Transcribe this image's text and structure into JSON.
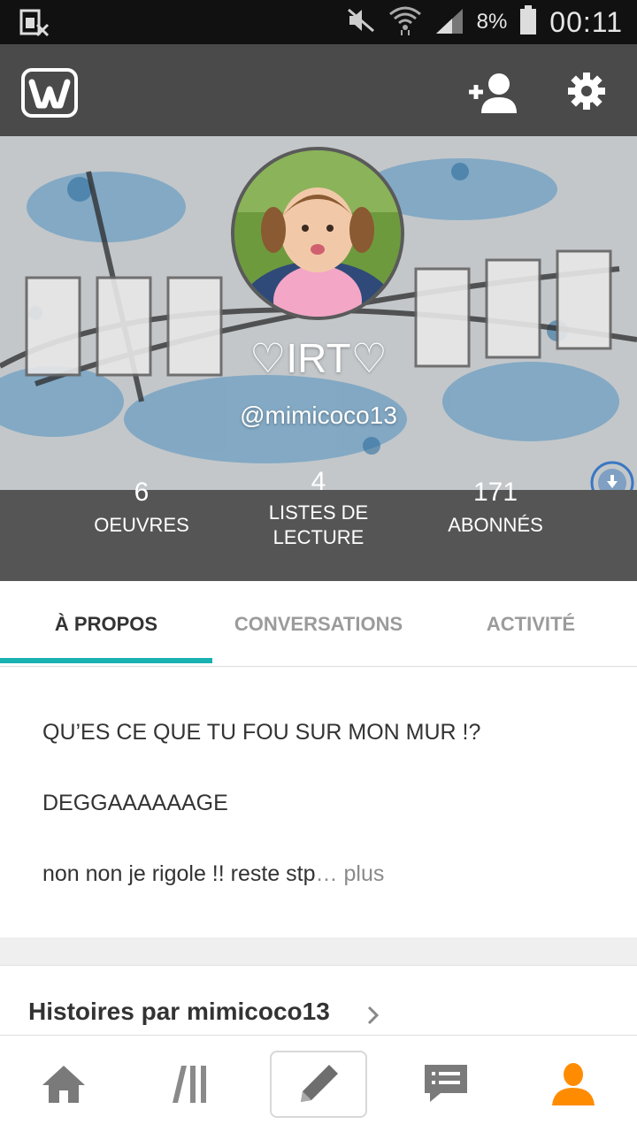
{
  "status_bar": {
    "battery_percent": "8%",
    "time": "00:11",
    "icons": [
      "sim-card-missing-icon",
      "mute-icon",
      "wifi-icon",
      "signal-icon",
      "battery-icon"
    ]
  },
  "app_bar": {
    "logo_icon": "wattpad-logo-icon",
    "actions": [
      "add-user-icon",
      "gear-icon"
    ]
  },
  "profile": {
    "display_name": "♡IRT♡",
    "username": "@mimicoco13"
  },
  "stats": [
    {
      "value": "6",
      "label": "OEUVRES"
    },
    {
      "value": "4",
      "label": "LISTES DE LECTURE",
      "label_line1": "LISTES DE",
      "label_line2": "LECTURE"
    },
    {
      "value": "171",
      "label": "ABONNÉS"
    }
  ],
  "tabs": [
    {
      "label": "À PROPOS",
      "active": true
    },
    {
      "label": "CONVERSATIONS",
      "active": false
    },
    {
      "label": "ACTIVITÉ",
      "active": false
    }
  ],
  "about": {
    "line1": "QU’ES CE QUE TU FOU SUR MON MUR !?",
    "line2": "DEGGAAAAAAGE",
    "line3": "non non je rigole !! reste stp",
    "ellipsis": "…",
    "more": "plus"
  },
  "stories_heading": "Histoires par mimicoco13",
  "bottom_nav": [
    "home-icon",
    "library-icon",
    "pencil-icon",
    "messages-icon",
    "profile-icon"
  ],
  "colors": {
    "accent": "#19b1b1",
    "app_bar": "#4a4a4a",
    "stats_bar": "#555555",
    "active_nav": "#ff8c00"
  }
}
